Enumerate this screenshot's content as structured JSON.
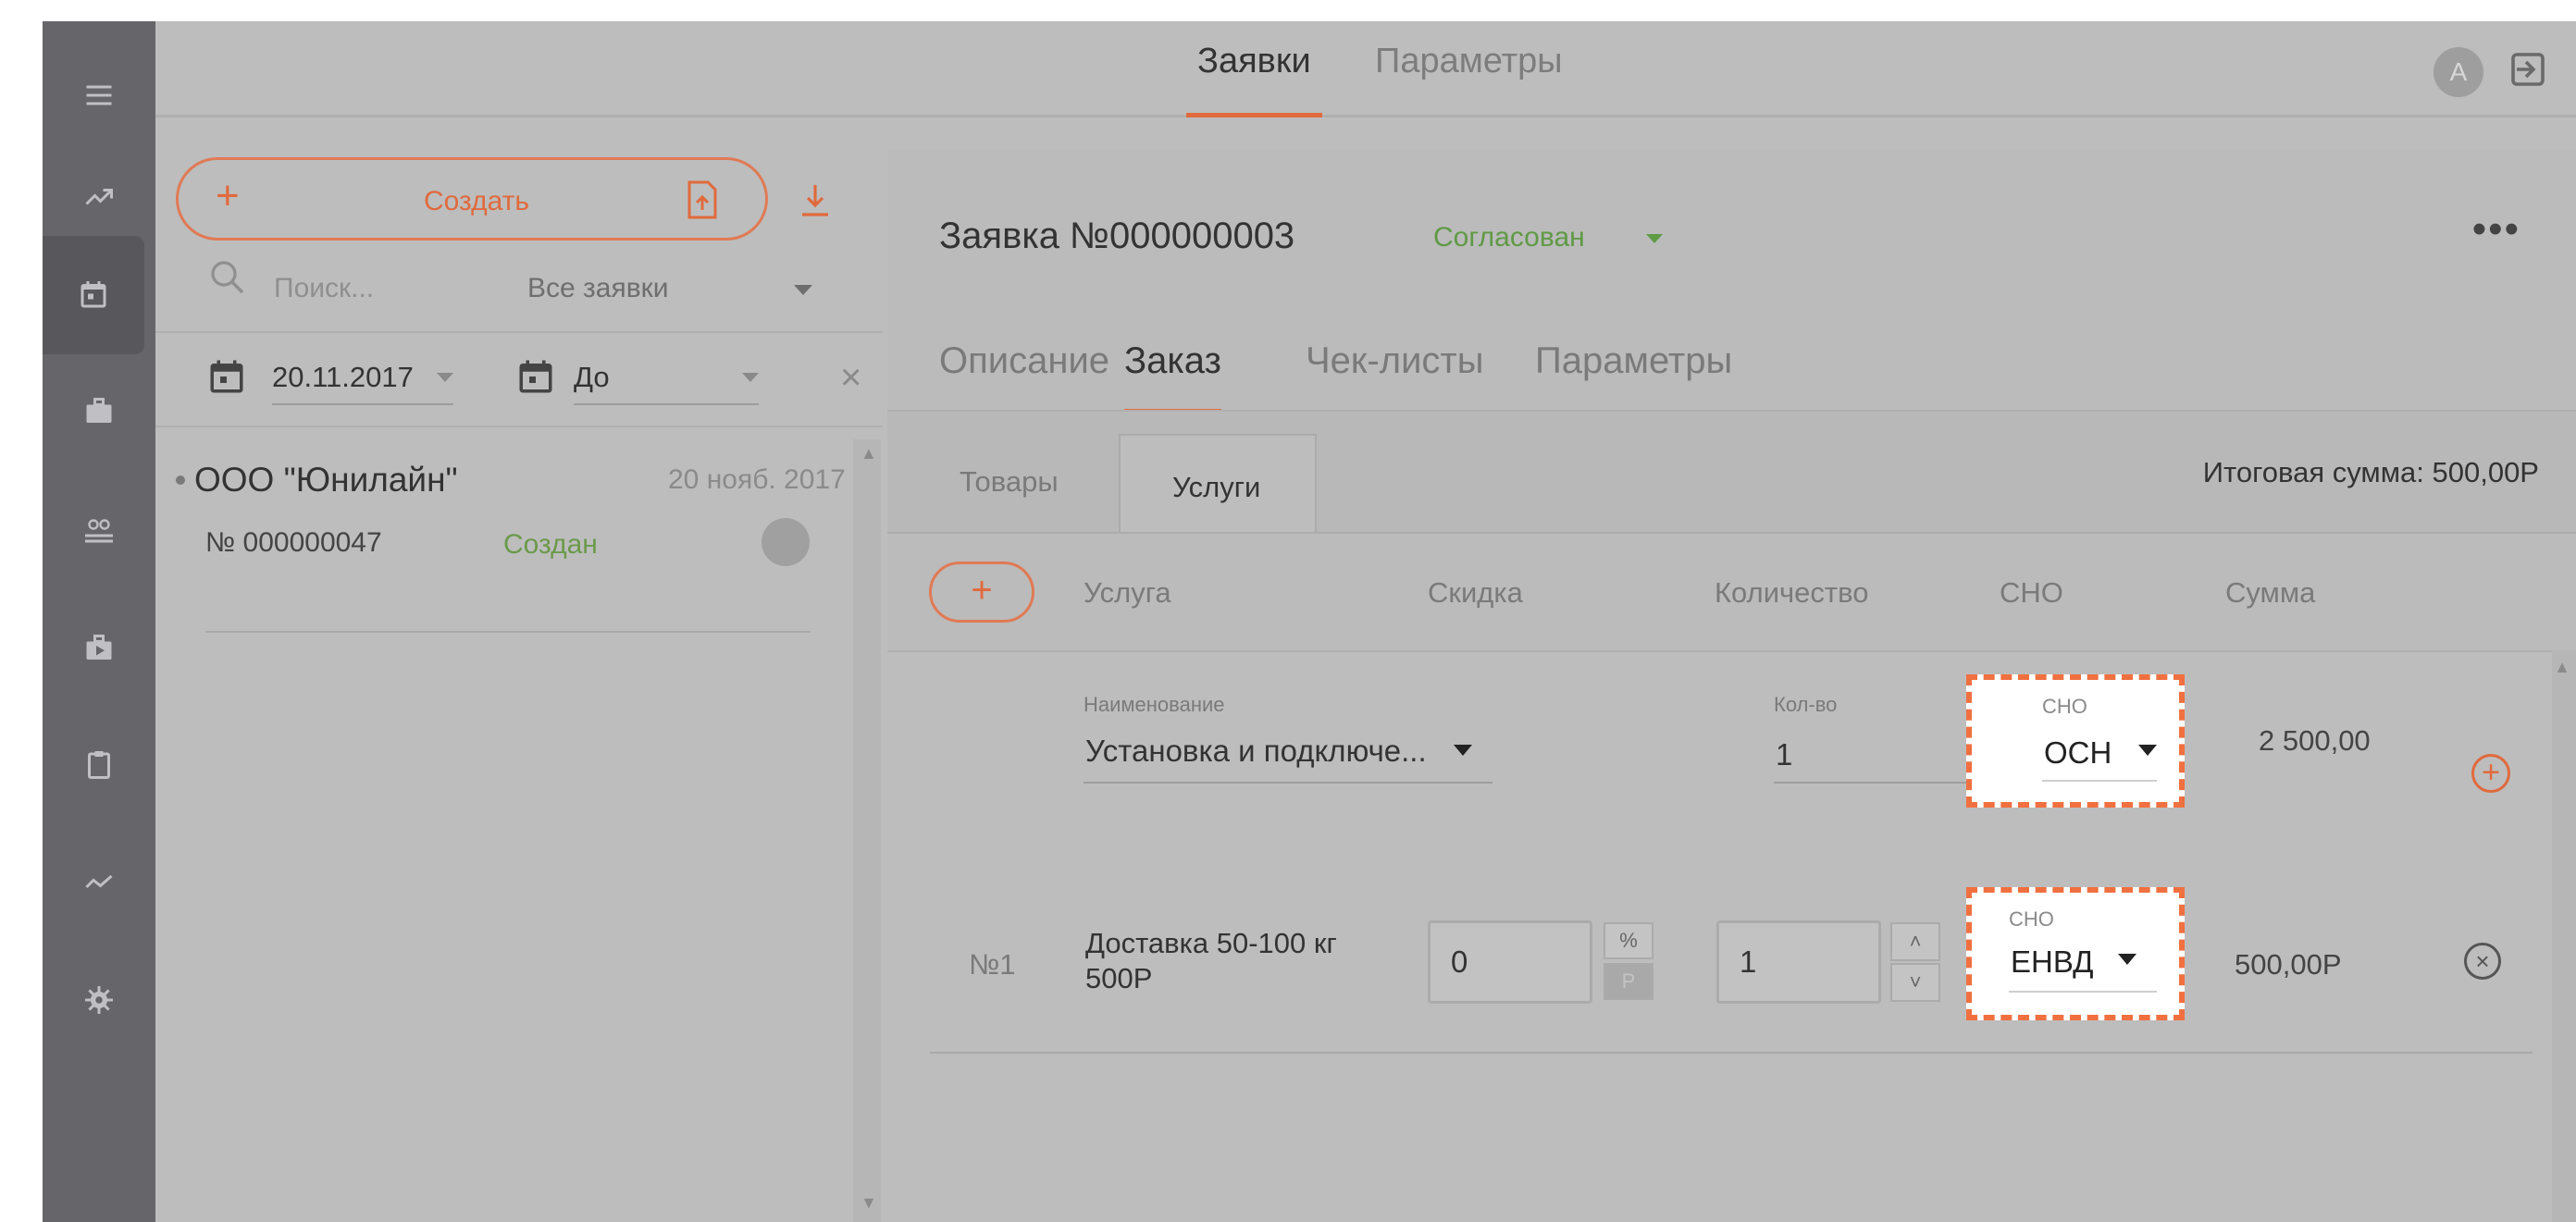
{
  "top_tabs": {
    "orders": "Заявки",
    "params": "Параметры"
  },
  "user": {
    "avatar_letter": "A"
  },
  "left": {
    "create_label": "Создать",
    "search_placeholder": "Поиск...",
    "filter_value": "Все заявки",
    "date_from": "20.11.2017",
    "date_to": "До",
    "items": [
      {
        "title": "ООО \"Юнилайн\"",
        "date": "20 нояб. 2017",
        "number": "№ 000000047",
        "status": "Создан"
      }
    ]
  },
  "order": {
    "title": "Заявка №000000003",
    "status": "Согласован",
    "tabs": [
      "Описание",
      "Заказ",
      "Чек-листы",
      "Параметры"
    ],
    "subtabs": [
      "Товары",
      "Услуги"
    ],
    "total": "Итоговая сумма: 500,00Р",
    "columns": [
      "Услуга",
      "Скидка",
      "Количество",
      "СНО",
      "Сумма"
    ],
    "new_row": {
      "name_label": "Наименование",
      "name_value": "Установка и подключе...",
      "qty_label": "Кол-во",
      "qty_value": "1",
      "sno_label": "СНО",
      "sno_value": "ОСН",
      "sum": "2 500,00"
    },
    "rows": [
      {
        "num": "№1",
        "name_line1": "Доставка 50-100 кг",
        "name_line2": "500Р",
        "discount": "0",
        "unit_pct": "%",
        "unit_rub": "Р",
        "qty": "1",
        "sno_label": "СНО",
        "sno_value": "ЕНВД",
        "sum": "500,00Р"
      }
    ]
  },
  "icons": [
    "menu-icon",
    "chart-icon",
    "calendar-icon",
    "briefcase-icon",
    "users-icon",
    "media-icon",
    "clipboard-icon",
    "trend-icon",
    "gear-icon",
    "logout-icon",
    "search-icon",
    "upload-icon",
    "download-icon"
  ],
  "colors": {
    "accent": "#e06a3d",
    "sidebar": "#66666a",
    "status_green": "#5f9a45",
    "highlight_border": "#f07040"
  }
}
